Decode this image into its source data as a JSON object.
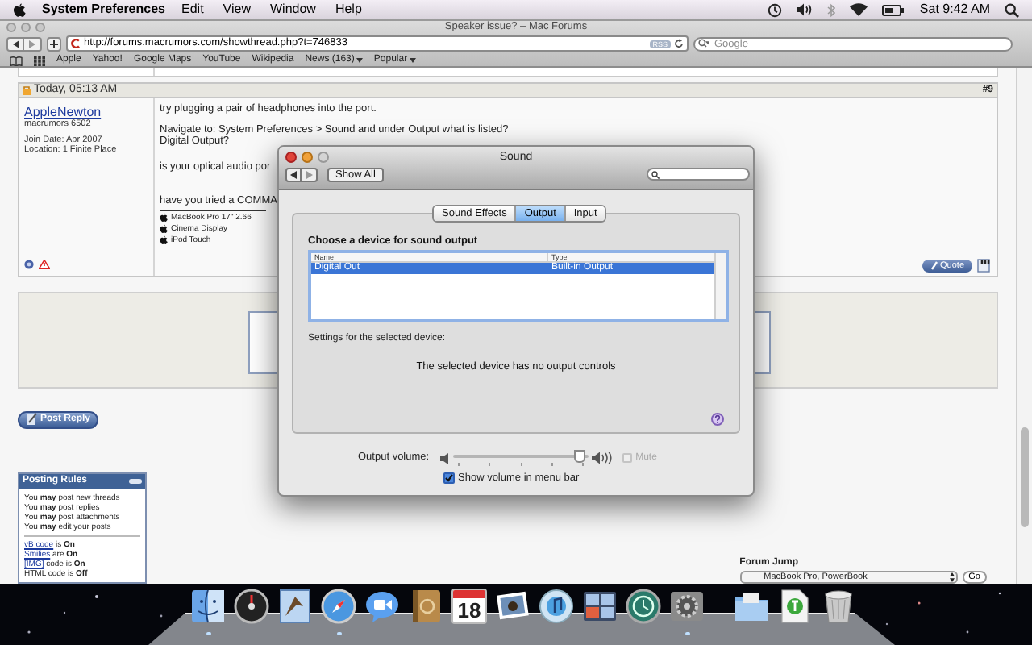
{
  "menu_bar": {
    "app": "System Preferences",
    "menus": [
      "Edit",
      "View",
      "Window",
      "Help"
    ],
    "clock": "Sat 9:42 AM"
  },
  "browser": {
    "title": "Speaker issue? – Mac Forums",
    "url": "http://forums.macrumors.com/showthread.php?t=746833",
    "rss_badge": "RSS",
    "search_placeholder": "Google",
    "bookmarks": [
      {
        "label": "Apple",
        "has_menu": false
      },
      {
        "label": "Yahoo!",
        "has_menu": false
      },
      {
        "label": "Google Maps",
        "has_menu": false
      },
      {
        "label": "YouTube",
        "has_menu": false
      },
      {
        "label": "Wikipedia",
        "has_menu": false
      },
      {
        "label": "News (163)",
        "has_menu": true
      },
      {
        "label": "Popular",
        "has_menu": true
      }
    ]
  },
  "post": {
    "date": "Today, 05:13 AM",
    "number": "#9",
    "author": "AppleNewton",
    "rank": "macrumors 6502",
    "join_date": "Join Date: Apr 2007",
    "location": "Location: 1 Finite Place",
    "lines": [
      "try plugging a pair of headphones into the port.",
      "Navigate to: System Preferences > Sound and under Output what is listed?",
      "Digital Output?",
      "is your optical audio por",
      "have you tried a COMMA"
    ],
    "signature": [
      "MacBook Pro 17\" 2.66",
      "Cinema Display",
      "iPod Touch"
    ],
    "quote_button": "Quote"
  },
  "post_reply_button": "Post Reply",
  "posting_rules": {
    "title": "Posting Rules",
    "permissions": [
      "You **may** post new threads",
      "You **may** post replies",
      "You **may** post attachments",
      "You **may** edit your posts"
    ],
    "codes": [
      {
        "link": "vB code",
        "text": "is **On**"
      },
      {
        "link": "Smilies",
        "text": "are **On**"
      },
      {
        "link": "[IMG]",
        "text": "code is **On**"
      },
      {
        "text": "HTML code is **Off**"
      }
    ]
  },
  "forum_jump": {
    "label": "Forum Jump",
    "value": "MacBook Pro, PowerBook",
    "button": "Go"
  },
  "sound_window": {
    "title": "Sound",
    "show_all": "Show All",
    "tabs": [
      {
        "label": "Sound Effects",
        "selected": false
      },
      {
        "label": "Output",
        "selected": true
      },
      {
        "label": "Input",
        "selected": false
      }
    ],
    "device_heading": "Choose a device for sound output",
    "columns": [
      "Name",
      "Type"
    ],
    "devices": [
      {
        "name": "Digital Out",
        "type": "Built-in Output",
        "selected": true
      }
    ],
    "settings_label": "Settings for the selected device:",
    "no_controls": "The selected device has no output controls",
    "volume_label": "Output volume:",
    "volume": {
      "level": 0.97
    },
    "mute": {
      "label": "Mute",
      "checked": false,
      "disabled": true
    },
    "show_volume": {
      "label": "Show volume in menu bar",
      "checked": true
    }
  },
  "dock": {
    "items": [
      {
        "kind": "finder",
        "running": true
      },
      {
        "kind": "dashboard",
        "running": false
      },
      {
        "kind": "mail",
        "running": false
      },
      {
        "kind": "safari",
        "running": true
      },
      {
        "kind": "chat",
        "running": false
      },
      {
        "kind": "address_book",
        "running": false
      },
      {
        "kind": "calendar",
        "date": "18",
        "running": false
      },
      {
        "kind": "photos",
        "running": false
      },
      {
        "kind": "music",
        "running": false
      },
      {
        "kind": "spaces",
        "running": false
      },
      {
        "kind": "time_machine",
        "running": false
      },
      {
        "kind": "system_preferences",
        "running": true
      },
      {
        "kind": "separator"
      },
      {
        "kind": "folder",
        "running": false
      },
      {
        "kind": "document",
        "running": false
      },
      {
        "kind": "trash",
        "running": false
      }
    ]
  }
}
